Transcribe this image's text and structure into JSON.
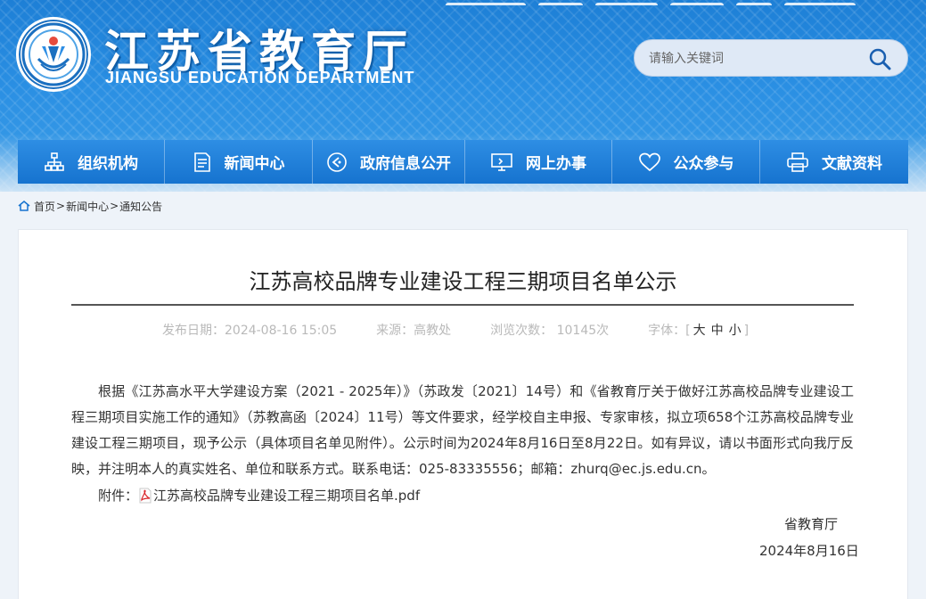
{
  "header": {
    "title_cn": "江苏省教育厅",
    "title_en": "JIANGSU EDUCATION DEPARTMENT",
    "search_placeholder": "请输入关键词"
  },
  "nav": {
    "items": [
      {
        "label": "组织机构",
        "icon": "org-chart-icon"
      },
      {
        "label": "新闻中心",
        "icon": "document-icon"
      },
      {
        "label": "政府信息公开",
        "icon": "announce-icon"
      },
      {
        "label": "网上办事",
        "icon": "monitor-icon"
      },
      {
        "label": "公众参与",
        "icon": "heart-icon"
      },
      {
        "label": "文献资料",
        "icon": "printer-icon"
      }
    ]
  },
  "breadcrumb": {
    "home": "首页",
    "sep1": ">",
    "news": "新闻中心",
    "sep2": ">",
    "current": "通知公告"
  },
  "article": {
    "title": "江苏高校品牌专业建设工程三期项目名单公示",
    "meta": {
      "publish_label": "发布日期：2024-08-16 15:05",
      "source_label": "来源：高教处",
      "views_label": "浏览次数： 10145次",
      "font_label": "字体：",
      "font_open": "[",
      "font_large": "大",
      "font_medium": "中",
      "font_small": "小",
      "font_close": "]"
    },
    "body": "根据《江苏高水平大学建设方案（2021 - 2025年）》（苏政发〔2021〕14号）和《省教育厅关于做好江苏高校品牌专业建设工程三期项目实施工作的通知》（苏教高函〔2024〕11号）等文件要求，经学校自主申报、专家审核，拟立项658个江苏高校品牌专业建设工程三期项目，现予公示（具体项目名单见附件）。公示时间为2024年8月16日至8月22日。如有异议，请以书面形式向我厅反映，并注明本人的真实姓名、单位和联系方式。联系电话：025-83335556；邮箱：zhurq@ec.js.edu.cn。",
    "attachment_label": "附件：",
    "attachment_name": "江苏高校品牌专业建设工程三期项目名单.pdf",
    "signature_org": "省教育厅",
    "signature_date": "2024年8月16日"
  },
  "colors": {
    "header_blue": "#2a8fe3",
    "nav_blue": "#1673cf",
    "pdf_red": "#d9262b"
  }
}
